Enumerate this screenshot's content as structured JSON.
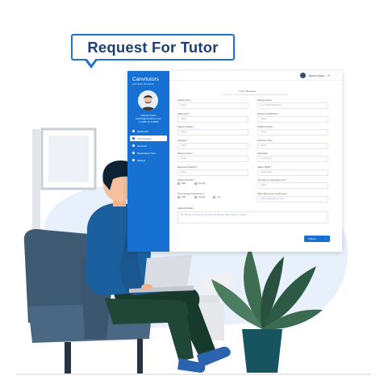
{
  "bubble": {
    "title": "Request For Tutor"
  },
  "app": {
    "logo": "Canvitutors",
    "logo_sub": "Learn Better with Experts",
    "user": {
      "name": "Jatindra Thaker",
      "email": "student@canvitutors.com",
      "phone": "+1 6256 12 12 8965"
    },
    "nav": [
      {
        "label": "Dashboard",
        "active": false
      },
      {
        "label": "Tutor Request",
        "active": true
      },
      {
        "label": "Hindi Lab",
        "active": false
      },
      {
        "label": "Bookmarked Tutor",
        "active": false
      },
      {
        "label": "Settings",
        "active": false
      }
    ],
    "topbar": {
      "user_name": "Jatindra Thaker",
      "icon1": "bell-icon",
      "icon2": "settings-icon"
    },
    "form_title": "Tutor Request",
    "left_fields": [
      {
        "label": "Grade Level *",
        "value": "Select"
      },
      {
        "label": "Select City *",
        "value": "Select"
      },
      {
        "label": "Select Location *",
        "value": "Select"
      },
      {
        "label": "Category *",
        "value": "Select"
      },
      {
        "label": "Select Course *",
        "value": "Select"
      },
      {
        "label": "Required Students *",
        "value": "Select"
      }
    ],
    "student_gender": {
      "label": "Student Gender *",
      "options": [
        "Male",
        "Female"
      ]
    },
    "tutor_gender": {
      "label": "Tutor Gender Preference *",
      "options": [
        "Male",
        "Female",
        "Any"
      ]
    },
    "address": {
      "label": "Address Details",
      "placeholder": "Eg. Plot No. 4, Street No. 34, Near the Mosque, DHA Phase 2, Karachi"
    },
    "right_fields": [
      {
        "label": "Student Name",
        "value": "E.g. Shahid Mehmood"
      },
      {
        "label": "Number of Students *",
        "value": "Select"
      },
      {
        "label": "Preferred Days",
        "value": "Select"
      },
      {
        "label": "Preferred Time",
        "value": "Select"
      },
      {
        "label": "Start Date",
        "value": "mm/dd/yyyy"
      },
      {
        "label": "Salary (PKR) *",
        "value": "Select salary"
      },
      {
        "label": "How did you hear about us? *",
        "value": "Select"
      }
    ],
    "requirement": {
      "label": "Write about your requirement",
      "placeholder": "Enter Requirements Here"
    },
    "submit_label": "Submit",
    "submit_arrow": "→"
  }
}
